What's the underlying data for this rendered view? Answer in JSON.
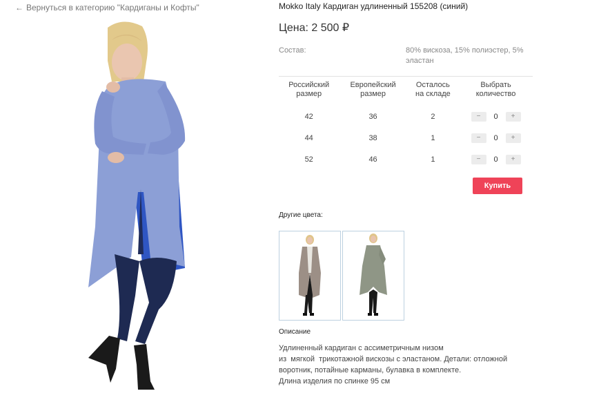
{
  "breadcrumb": {
    "back_label": "Вернуться в категорию \"Кардиганы и Кофты\""
  },
  "product": {
    "title": "Mokko Italy Кардиган удлиненный 155208 (синий)",
    "price": "Цена: 2 500 ₽",
    "composition_label": "Состав:",
    "composition_value": "80% вискоза, 15% полиэстер, 5% эластан"
  },
  "sizes_table": {
    "headers": [
      "Российский\nразмер",
      "Европейский\nразмер",
      "Осталось\nна складе",
      "Выбрать\nколичество"
    ],
    "rows": [
      {
        "ru": "42",
        "eu": "36",
        "stock": "2",
        "qty": "0"
      },
      {
        "ru": "44",
        "eu": "38",
        "stock": "1",
        "qty": "0"
      },
      {
        "ru": "52",
        "eu": "46",
        "stock": "1",
        "qty": "0"
      }
    ],
    "minus": "−",
    "plus": "+"
  },
  "buy_label": "Купить",
  "other_colors": {
    "title": "Другие цвета:"
  },
  "description": {
    "title": "Описание",
    "lines": [
      "Удлиненный кардиган с ассиметричным низом",
      "из  мягкой  трикотажной вискозы с эластаном. Детали: отложной",
      "воротник, потайные карманы, булавка в комплекте.",
      "Длина изделия по спинке 95 см"
    ]
  },
  "colors": {
    "accent": "#ef4358",
    "main_garment": "#8c9fd6",
    "thumb1_garment": "#9c8f86",
    "thumb2_garment": "#8f9686"
  }
}
